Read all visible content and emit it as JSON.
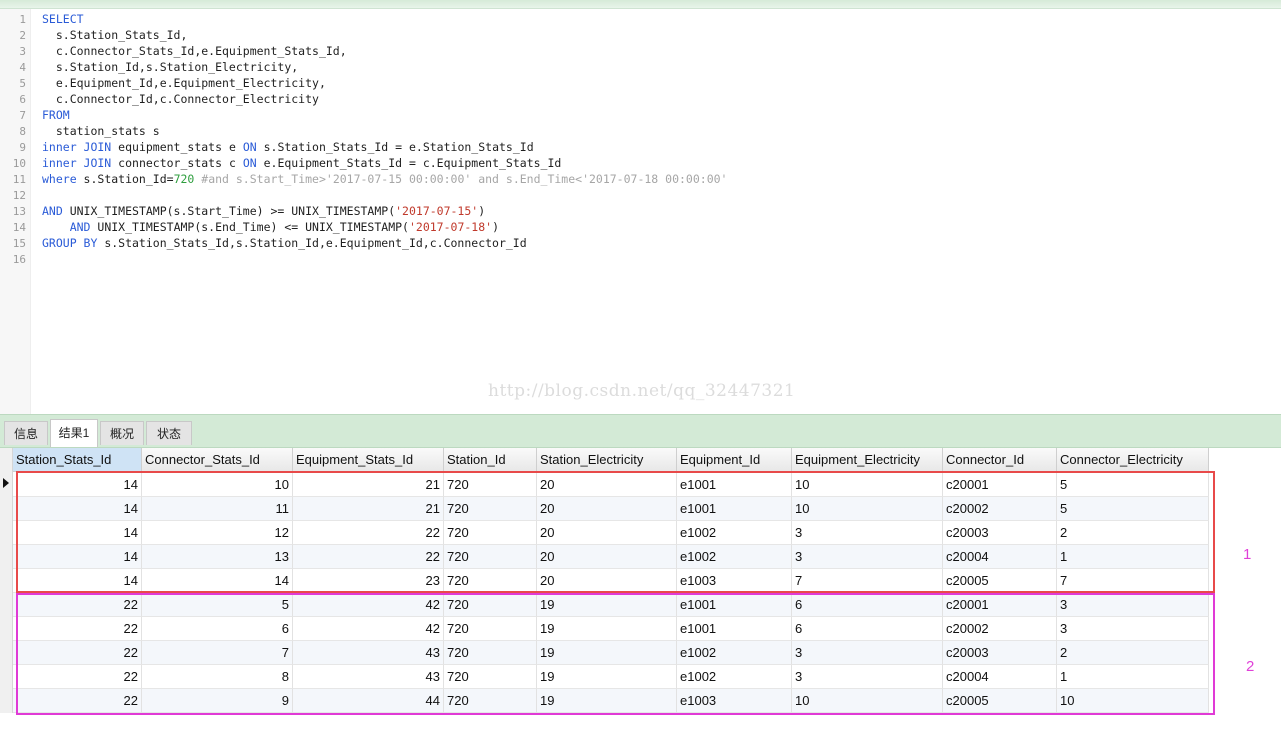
{
  "editor": {
    "lines": [
      {
        "n": "1",
        "parts": [
          {
            "t": "SELECT",
            "c": "kw"
          }
        ]
      },
      {
        "n": "2",
        "parts": [
          {
            "t": "  s.Station_Stats_Id,",
            "c": ""
          }
        ]
      },
      {
        "n": "3",
        "parts": [
          {
            "t": "  c.Connector_Stats_Id,e.Equipment_Stats_Id,",
            "c": ""
          }
        ]
      },
      {
        "n": "4",
        "parts": [
          {
            "t": "  s.Station_Id,s.Station_Electricity,",
            "c": ""
          }
        ]
      },
      {
        "n": "5",
        "parts": [
          {
            "t": "  e.Equipment_Id,e.Equipment_Electricity,",
            "c": ""
          }
        ]
      },
      {
        "n": "6",
        "parts": [
          {
            "t": "  c.Connector_Id,c.Connector_Electricity",
            "c": ""
          }
        ]
      },
      {
        "n": "7",
        "parts": [
          {
            "t": "FROM",
            "c": "kw"
          }
        ]
      },
      {
        "n": "8",
        "parts": [
          {
            "t": "  station_stats s",
            "c": ""
          }
        ]
      },
      {
        "n": "9",
        "parts": [
          {
            "t": "inner JOIN",
            "c": "kw"
          },
          {
            "t": " equipment_stats e ",
            "c": ""
          },
          {
            "t": "ON",
            "c": "kw"
          },
          {
            "t": " s.Station_Stats_Id = e.Station_Stats_Id",
            "c": ""
          }
        ]
      },
      {
        "n": "10",
        "parts": [
          {
            "t": "inner JOIN",
            "c": "kw"
          },
          {
            "t": " connector_stats c ",
            "c": ""
          },
          {
            "t": "ON",
            "c": "kw"
          },
          {
            "t": " e.Equipment_Stats_Id = c.Equipment_Stats_Id",
            "c": ""
          }
        ]
      },
      {
        "n": "11",
        "parts": [
          {
            "t": "where",
            "c": "kw"
          },
          {
            "t": " s.Station_Id=",
            "c": ""
          },
          {
            "t": "720",
            "c": "num"
          },
          {
            "t": " #and s.Start_Time>'2017-07-15 00:00:00' and s.End_Time<'2017-07-18 00:00:00'",
            "c": "cmt"
          }
        ]
      },
      {
        "n": "12",
        "parts": []
      },
      {
        "n": "13",
        "parts": [
          {
            "t": "AND",
            "c": "kw"
          },
          {
            "t": " UNIX_TIMESTAMP(s.Start_Time) >= UNIX_TIMESTAMP(",
            "c": ""
          },
          {
            "t": "'2017-07-15'",
            "c": "str"
          },
          {
            "t": ")",
            "c": ""
          }
        ]
      },
      {
        "n": "14",
        "parts": [
          {
            "t": "    ",
            "c": ""
          },
          {
            "t": "AND",
            "c": "kw"
          },
          {
            "t": " UNIX_TIMESTAMP(s.End_Time) <= UNIX_TIMESTAMP(",
            "c": ""
          },
          {
            "t": "'2017-07-18'",
            "c": "str"
          },
          {
            "t": ")",
            "c": ""
          }
        ]
      },
      {
        "n": "15",
        "parts": [
          {
            "t": "GROUP BY",
            "c": "kw"
          },
          {
            "t": " s.Station_Stats_Id,s.Station_Id,e.Equipment_Id,c.Connector_Id",
            "c": ""
          }
        ]
      },
      {
        "n": "16",
        "parts": []
      }
    ],
    "watermark": "http://blog.csdn.net/qq_32447321"
  },
  "tabs": [
    {
      "label": "信息",
      "active": false
    },
    {
      "label": "结果1",
      "active": true
    },
    {
      "label": "概况",
      "active": false
    },
    {
      "label": "状态",
      "active": false
    }
  ],
  "grid": {
    "columns": [
      "Station_Stats_Id",
      "Connector_Stats_Id",
      "Equipment_Stats_Id",
      "Station_Id",
      "Station_Electricity",
      "Equipment_Id",
      "Equipment_Electricity",
      "Connector_Id",
      "Connector_Electricity"
    ],
    "rows": [
      [
        "14",
        "10",
        "21",
        "720",
        "20",
        "e1001",
        "10",
        "c20001",
        "5"
      ],
      [
        "14",
        "11",
        "21",
        "720",
        "20",
        "e1001",
        "10",
        "c20002",
        "5"
      ],
      [
        "14",
        "12",
        "22",
        "720",
        "20",
        "e1002",
        "3",
        "c20003",
        "2"
      ],
      [
        "14",
        "13",
        "22",
        "720",
        "20",
        "e1002",
        "3",
        "c20004",
        "1"
      ],
      [
        "14",
        "14",
        "23",
        "720",
        "20",
        "e1003",
        "7",
        "c20005",
        "7"
      ],
      [
        "22",
        "5",
        "42",
        "720",
        "19",
        "e1001",
        "6",
        "c20001",
        "3"
      ],
      [
        "22",
        "6",
        "42",
        "720",
        "19",
        "e1001",
        "6",
        "c20002",
        "3"
      ],
      [
        "22",
        "7",
        "43",
        "720",
        "19",
        "e1002",
        "3",
        "c20003",
        "2"
      ],
      [
        "22",
        "8",
        "43",
        "720",
        "19",
        "e1002",
        "3",
        "c20004",
        "1"
      ],
      [
        "22",
        "9",
        "44",
        "720",
        "19",
        "e1003",
        "10",
        "c20005",
        "10"
      ]
    ]
  },
  "annotations": {
    "group1_label": "1",
    "group2_label": "2",
    "group1_color": "#e84a4a",
    "group2_color": "#e03ad6"
  }
}
